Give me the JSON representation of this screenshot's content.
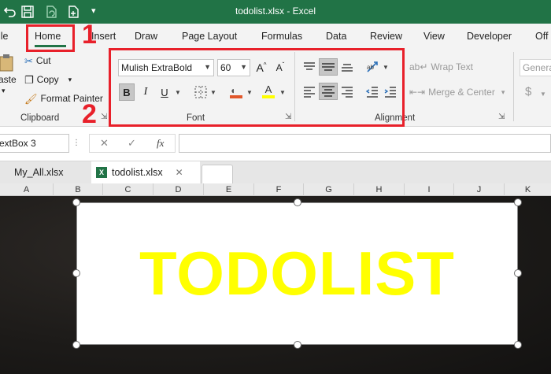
{
  "window": {
    "title": "todolist.xlsx  -  Excel"
  },
  "ribbon_tabs": [
    "ile",
    "Home",
    "Insert",
    "Draw",
    "Page Layout",
    "Formulas",
    "Data",
    "Review",
    "View",
    "Developer",
    "Off"
  ],
  "clipboard": {
    "paste_label": "aste",
    "cut_label": "Cut",
    "copy_label": "Copy",
    "format_painter_label": "Format Painter",
    "group_label": "Clipboard"
  },
  "font": {
    "font_name": "Mulish ExtraBold",
    "font_size": "60",
    "group_label": "Font",
    "bold_label": "B",
    "italic_label": "I",
    "underline_label": "U",
    "grow_label": "A",
    "shrink_label": "A",
    "fill_label": "A"
  },
  "alignment": {
    "wrap_text_label": "Wrap Text",
    "merge_label": "Merge & Center",
    "group_label": "Alignment"
  },
  "number": {
    "format_label": "Genera",
    "currency_label": "$"
  },
  "annotations": {
    "one": "1",
    "two": "2"
  },
  "formula_bar": {
    "name_box": "extBox 3",
    "fx_label": "fx",
    "formula_value": ""
  },
  "workbook_tabs": [
    {
      "label": "My_All.xlsx"
    },
    {
      "label": "todolist.xlsx"
    }
  ],
  "columns": [
    "A",
    "B",
    "C",
    "D",
    "E",
    "F",
    "G",
    "H",
    "I",
    "J",
    "K"
  ],
  "textbox": {
    "text": "TODOLIST"
  },
  "colors": {
    "excel_green": "#217346",
    "annotation_red": "#e8202a",
    "text_yellow": "#ffff00"
  }
}
